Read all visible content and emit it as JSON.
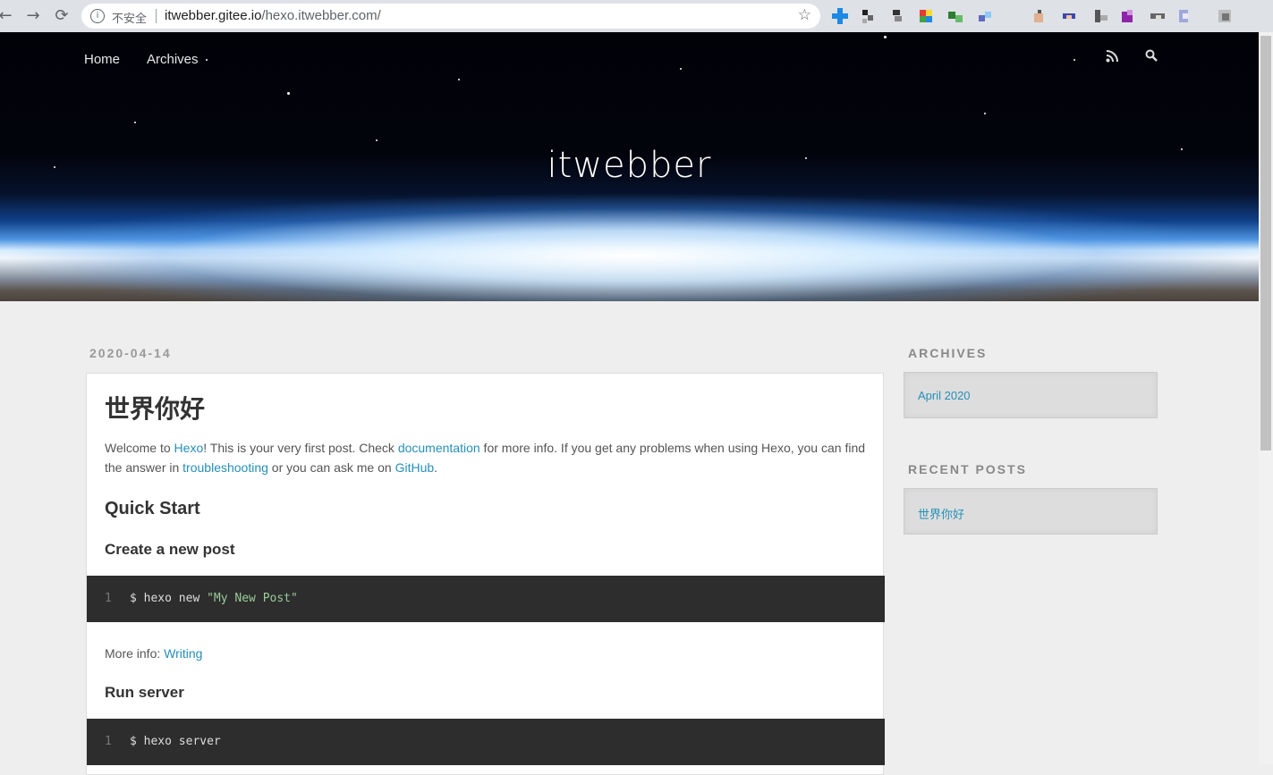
{
  "browser": {
    "security_label": "不安全",
    "url_host": "itwebber.gitee.io",
    "url_path": "/hexo.itwebber.com/"
  },
  "nav": {
    "home": "Home",
    "archives": "Archives"
  },
  "site": {
    "title": "itwebber"
  },
  "post": {
    "date": "2020-04-14",
    "title": "世界你好",
    "intro": {
      "t1": "Welcome to ",
      "link_hexo": "Hexo",
      "t2": "! This is your very first post. Check ",
      "link_docs": "documentation",
      "t3": " for more info. If you get any problems when using Hexo, you can find the answer in ",
      "link_troubleshooting": "troubleshooting",
      "t4": " or you can ask me on ",
      "link_github": "GitHub",
      "t5": "."
    },
    "quick_start": "Quick Start",
    "create_post": "Create a new post",
    "code1": {
      "line": "1",
      "cmd": "$ hexo new ",
      "arg": "\"My New Post\""
    },
    "more_info_label": "More info: ",
    "more_info_link": "Writing",
    "run_server": "Run server",
    "code2": {
      "line": "1",
      "cmd": "$ hexo server"
    }
  },
  "sidebar": {
    "archives_title": "ARCHIVES",
    "archive_item": "April 2020",
    "recent_title": "RECENT POSTS",
    "recent_item": "世界你好"
  }
}
